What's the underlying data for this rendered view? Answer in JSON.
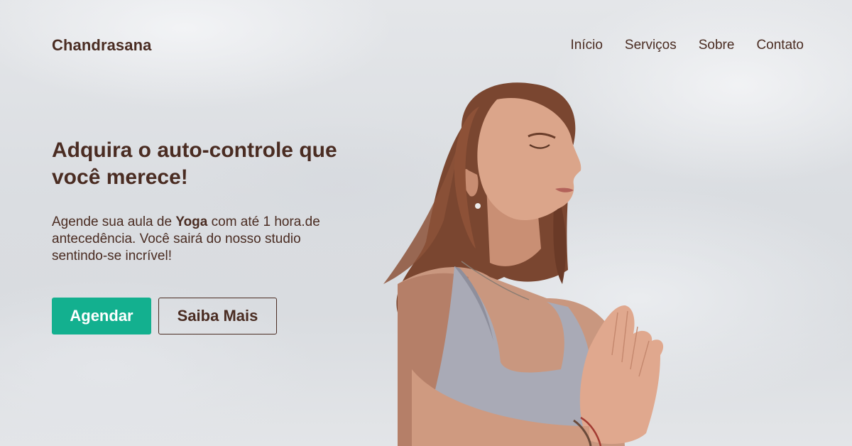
{
  "brand": {
    "name": "Chandrasana"
  },
  "nav": {
    "items": [
      {
        "label": "Início"
      },
      {
        "label": "Serviços"
      },
      {
        "label": "Sobre"
      },
      {
        "label": "Contato"
      }
    ]
  },
  "hero": {
    "headline": "Adquira o auto-controle que você merece!",
    "subtext": {
      "before": "Agende sua aula de ",
      "emphasis": "Yoga",
      "after": " com até 1 hora.de antecedência. Você sairá do nosso studio sentindo-se incrível!"
    },
    "primary_button": "Agendar",
    "secondary_button": "Saiba Mais",
    "image": "woman-meditating-with-praying-hands"
  },
  "colors": {
    "text": "#4a2c22",
    "accent": "#13b08f",
    "sky": "#dfe1e4"
  }
}
